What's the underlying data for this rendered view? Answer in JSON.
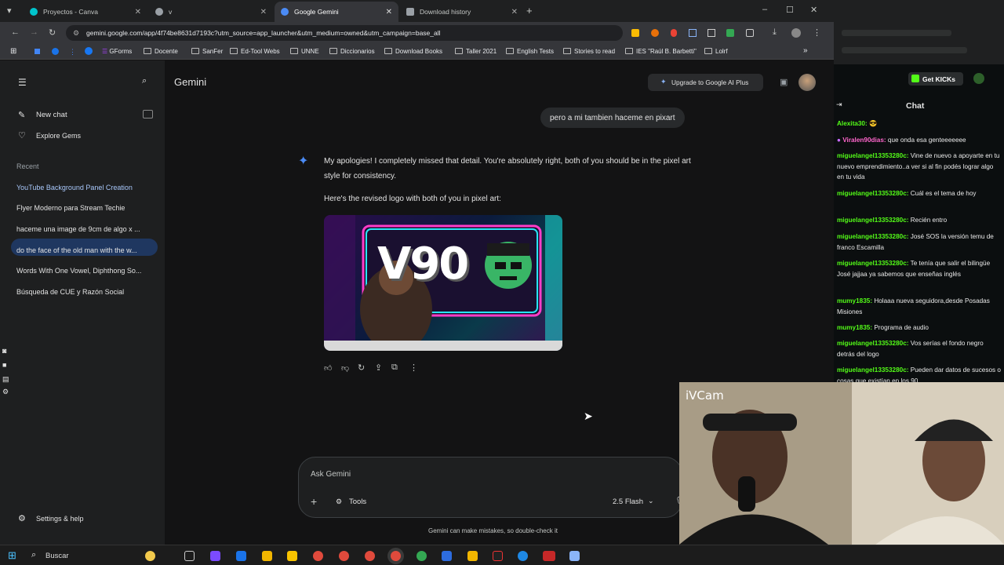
{
  "browser": {
    "tabs": [
      {
        "label": "Proyectos - Canva",
        "color": "#00c4cc"
      },
      {
        "label": "v",
        "color": "#9aa0a6"
      },
      {
        "label": "Google Gemini",
        "color": "#4b8bf5"
      },
      {
        "label": "Download history",
        "color": "#9aa0a6"
      }
    ],
    "url": "gemini.google.com/app/4f74be8631d7193c?utm_source=app_launcher&utm_medium=owned&utm_campaign=base_all",
    "bookmarks": [
      "GForms",
      "Docente",
      "SanFer",
      "Ed-Tool Webs",
      "UNNE",
      "Diccionarios",
      "Download Books",
      "Taller 2021",
      "English Tests",
      "Stories to read",
      "IES \"Raúl B. Barbetti\"",
      "Lolrf"
    ]
  },
  "gemini": {
    "app_title": "Gemini",
    "upgrade_label": "Upgrade to Google AI Plus",
    "new_chat": "New chat",
    "explore_gems": "Explore Gems",
    "recent_heading": "Recent",
    "recent": [
      "YouTube Background Panel Creation",
      "Flyer Moderno para Stream Techie",
      "haceme una image de 9cm de algo x ...",
      "do the face of the old man with the w...",
      "Words With One Vowel, Diphthong So...",
      "Búsqueda de CUE y Razón Social"
    ],
    "settings": "Settings & help",
    "user_message": "pero a mi tambien haceme en pixart",
    "reply_p1": "My apologies! I completely missed that detail. You're absolutely right, both of you should be in the pixel art style for consistency.",
    "reply_p2": "Here's the revised logo with both of you in pixel art:",
    "image_text": "V90",
    "input_placeholder": "Ask Gemini",
    "tools_label": "Tools",
    "model_label": "2.5 Flash",
    "disclaimer": "Gemini can make mistakes, so double-check it"
  },
  "kick": {
    "get_button": "Get KICKs",
    "chat_title": "Chat",
    "messages": [
      {
        "user": "Alexita30:",
        "text": "",
        "pink": false
      },
      {
        "user": "Viralen90dias:",
        "text": "que onda esa genteeeeeee",
        "pink": true
      },
      {
        "user": "miguelangel13353280c:",
        "text": "Vine de nuevo a apoyarte en tu nuevo emprendimiento..a ver si al fin podés lograr algo en tu vida",
        "pink": false
      },
      {
        "user": "miguelangel13353280c:",
        "text": "Cuál es el tema de hoy",
        "pink": false
      },
      {
        "user": "miguelangel13353280c:",
        "text": "Recién entro",
        "pink": false
      },
      {
        "user": "miguelangel13353280c:",
        "text": "José SOS la versión temu de franco Escamilla",
        "pink": false
      },
      {
        "user": "miguelangel13353280c:",
        "text": "Te tenía que salir el bilingüe José jajjaa ya sabemos que enseñas inglés",
        "pink": false
      },
      {
        "user": "mumy1835:",
        "text": "Holaaa nueva seguidora,desde Posadas Misiones",
        "pink": false
      },
      {
        "user": "mumy1835:",
        "text": "Programa de audio",
        "pink": false
      },
      {
        "user": "miguelangel13353280c:",
        "text": "Vos serías el fondo negro detrás del logo",
        "pink": false
      },
      {
        "user": "miguelangel13353280c:",
        "text": "Pueden dar datos de sucesos o cosas que existían en los 90",
        "pink": false
      }
    ]
  },
  "webcam": {
    "label": "iVCam"
  },
  "taskbar": {
    "search_label": "Buscar"
  }
}
